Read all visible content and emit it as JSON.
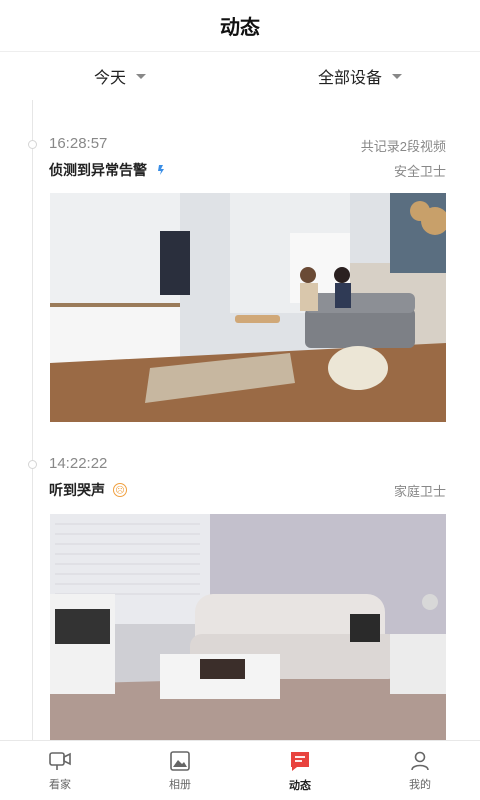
{
  "header": {
    "title": "动态"
  },
  "filters": {
    "date": "今天",
    "devices": "全部设备"
  },
  "events": [
    {
      "time": "16:28:57",
      "count": "共记录2段视频",
      "label": "侦测到异常告警",
      "device": "安全卫士",
      "badge": "motion-icon"
    },
    {
      "time": "14:22:22",
      "count": "",
      "label": "听到哭声",
      "device": "家庭卫士",
      "badge": "crying-face-icon"
    }
  ],
  "tabs": [
    {
      "label": "看家",
      "icon": "camera-icon"
    },
    {
      "label": "相册",
      "icon": "album-icon"
    },
    {
      "label": "动态",
      "icon": "activity-icon",
      "active": true
    },
    {
      "label": "我的",
      "icon": "profile-icon"
    }
  ],
  "colors": {
    "accent": "#e8423d",
    "muted": "#888888"
  }
}
